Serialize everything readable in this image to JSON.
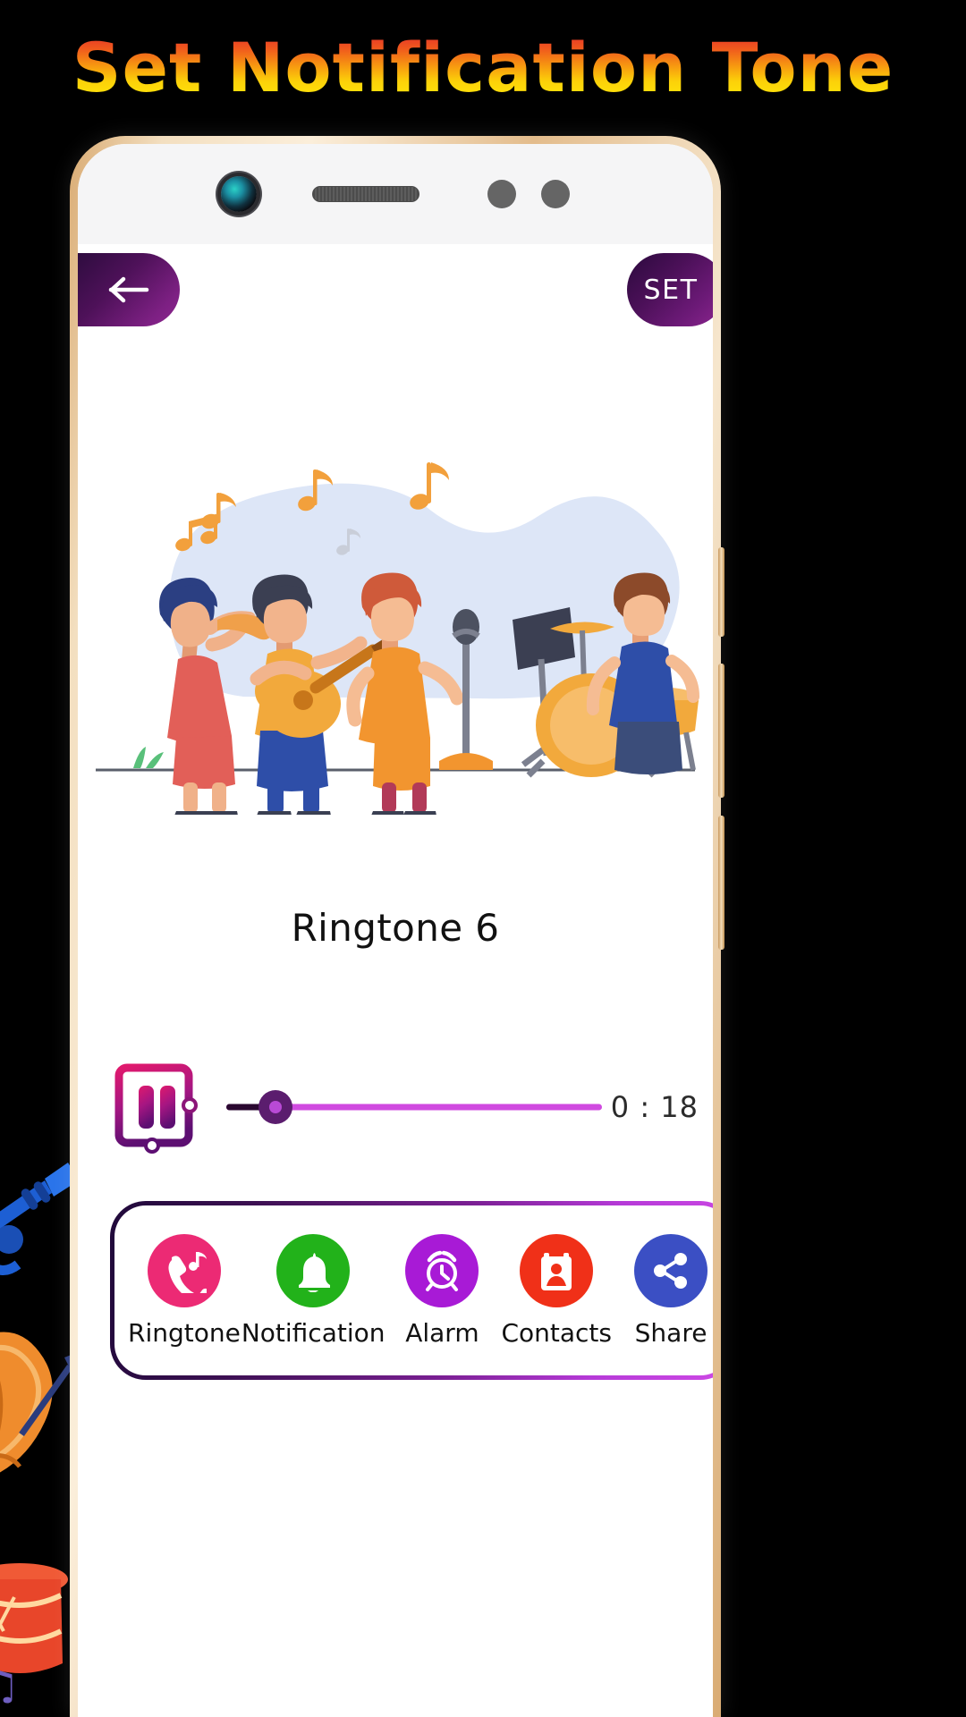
{
  "banner": {
    "title": "Set Notification Tone",
    "title_gradient_top": "#e63228",
    "title_gradient_bottom": "#ffe80a",
    "background": "#000000"
  },
  "phone": {
    "frame_color": "#e3bc8c",
    "front_color": "#ffffff",
    "sensors": {
      "camera": "camera-icon",
      "earpiece": "speaker-grille",
      "proximity_dot": "sensor-dot",
      "light_dot": "sensor-dot"
    }
  },
  "app": {
    "header": {
      "back_icon": "arrow-left-icon",
      "back_label": "Back",
      "set_label": "SET",
      "button_gradient_start": "#2b0a3d",
      "button_gradient_end": "#8e2690"
    },
    "illustration": {
      "name": "band-playing-music-illustration",
      "blob_color": "#dde6f7",
      "accent_color": "#f08a3c",
      "notes": [
        "note-icon",
        "note-icon",
        "note-icon",
        "note-icon",
        "note-icon"
      ]
    },
    "track": {
      "title": "Ringtone 6"
    },
    "player": {
      "state": "playing",
      "pause_icon": "pause-icon",
      "progress_percent": 13,
      "time_label": "0 : 18",
      "track_color": "#d04ae0",
      "fill_color": "#2a0930",
      "thumb_color": "#5b1d6e"
    },
    "actions": [
      {
        "label": "Ringtone",
        "icon": "phone-music-icon",
        "color": "#ec2a74"
      },
      {
        "label": "Notification",
        "icon": "bell-icon",
        "color": "#22b21a"
      },
      {
        "label": "Alarm",
        "icon": "alarm-clock-icon",
        "color": "#a81ad6"
      },
      {
        "label": "Contacts",
        "icon": "contact-card-icon",
        "color": "#f03018"
      },
      {
        "label": "Share",
        "icon": "share-icon",
        "color": "#3b4fc4"
      }
    ],
    "panel_border_gradient_start": "#20093a",
    "panel_border_gradient_end": "#cf4ae6"
  }
}
